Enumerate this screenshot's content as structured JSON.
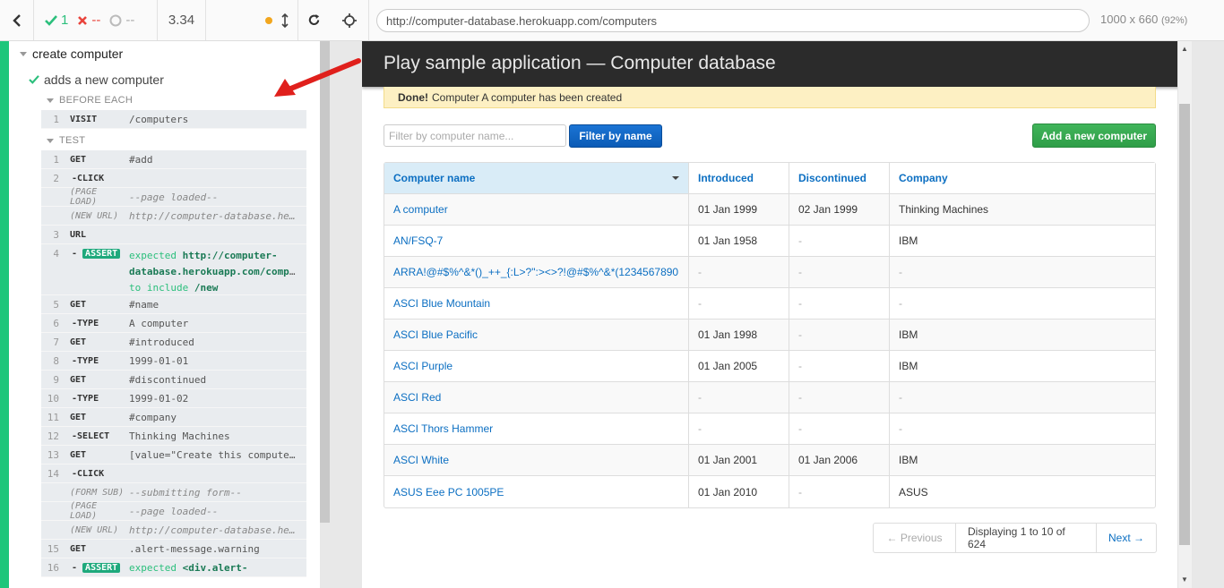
{
  "reporter": {
    "stats": {
      "passed": "1",
      "failed": "--",
      "pending": "--"
    },
    "duration": "3.34",
    "suite_title": "create computer",
    "test_title": "adds a new computer",
    "before_each_label": "BEFORE EACH",
    "test_label": "TEST",
    "before_each_commands": [
      {
        "num": "1",
        "name": "VISIT",
        "msg": "/computers"
      }
    ],
    "test_commands": [
      {
        "num": "1",
        "name": "GET",
        "msg": "#add"
      },
      {
        "num": "2",
        "name": "-CLICK",
        "msg": ""
      },
      {
        "num": "",
        "name": "(PAGE LOAD)",
        "msg": "--page loaded--"
      },
      {
        "num": "",
        "name": "(NEW URL)",
        "msg": "http://computer-database.herokuapp.com/computers/new"
      },
      {
        "num": "3",
        "name": "URL",
        "msg": ""
      },
      {
        "num": "4",
        "name": "ASSERT",
        "expected": "expected",
        "url": "http://computer-database.herokuapp.com/computers/new",
        "to_include": "to include",
        "include_val": "/new"
      },
      {
        "num": "5",
        "name": "GET",
        "msg": "#name"
      },
      {
        "num": "6",
        "name": "-TYPE",
        "msg": "A computer"
      },
      {
        "num": "7",
        "name": "GET",
        "msg": "#introduced"
      },
      {
        "num": "8",
        "name": "-TYPE",
        "msg": "1999-01-01"
      },
      {
        "num": "9",
        "name": "GET",
        "msg": "#discontinued"
      },
      {
        "num": "10",
        "name": "-TYPE",
        "msg": "1999-01-02"
      },
      {
        "num": "11",
        "name": "GET",
        "msg": "#company"
      },
      {
        "num": "12",
        "name": "-SELECT",
        "msg": "Thinking Machines"
      },
      {
        "num": "13",
        "name": "GET",
        "msg": "[value=\"Create this computer\"]"
      },
      {
        "num": "14",
        "name": "-CLICK",
        "msg": ""
      },
      {
        "num": "",
        "name": "(FORM SUB)",
        "msg": "--submitting form--"
      },
      {
        "num": "",
        "name": "(PAGE LOAD)",
        "msg": "--page loaded--"
      },
      {
        "num": "",
        "name": "(NEW URL)",
        "msg": "http://computer-database.herokuapp.com/computers"
      },
      {
        "num": "15",
        "name": "GET",
        "msg": ".alert-message.warning"
      },
      {
        "num": "16",
        "name": "ASSERT",
        "expected": "expected",
        "msg": "<div.alert-"
      }
    ]
  },
  "aut": {
    "url": "http://computer-database.herokuapp.com/computers",
    "viewport": "1000 x 660",
    "scale": "(92%)",
    "app_title": "Play sample application — Computer database",
    "alert_strong": "Done!",
    "alert_text": "Computer A computer has been created",
    "filter_placeholder": "Filter by computer name...",
    "filter_button": "Filter by name",
    "add_button": "Add a new computer",
    "columns": [
      "Computer name",
      "Introduced",
      "Discontinued",
      "Company"
    ],
    "rows": [
      [
        "A computer",
        "01 Jan 1999",
        "02 Jan 1999",
        "Thinking Machines"
      ],
      [
        "AN/FSQ-7",
        "01 Jan 1958",
        "-",
        "IBM"
      ],
      [
        "ARRA!@#$%^&*()_++_{:L>?\":><>?!@#$%^&*(1234567890",
        "-",
        "-",
        "-"
      ],
      [
        "ASCI Blue Mountain",
        "-",
        "-",
        "-"
      ],
      [
        "ASCI Blue Pacific",
        "01 Jan 1998",
        "-",
        "IBM"
      ],
      [
        "ASCI Purple",
        "01 Jan 2005",
        "-",
        "IBM"
      ],
      [
        "ASCI Red",
        "-",
        "-",
        "-"
      ],
      [
        "ASCI Thors Hammer",
        "-",
        "-",
        "-"
      ],
      [
        "ASCI White",
        "01 Jan 2001",
        "01 Jan 2006",
        "IBM"
      ],
      [
        "ASUS Eee PC 1005PE",
        "01 Jan 2010",
        "-",
        "ASUS"
      ]
    ],
    "pager": {
      "prev": "← Previous",
      "current": "Displaying 1 to 10 of 624",
      "next": "Next →"
    }
  }
}
